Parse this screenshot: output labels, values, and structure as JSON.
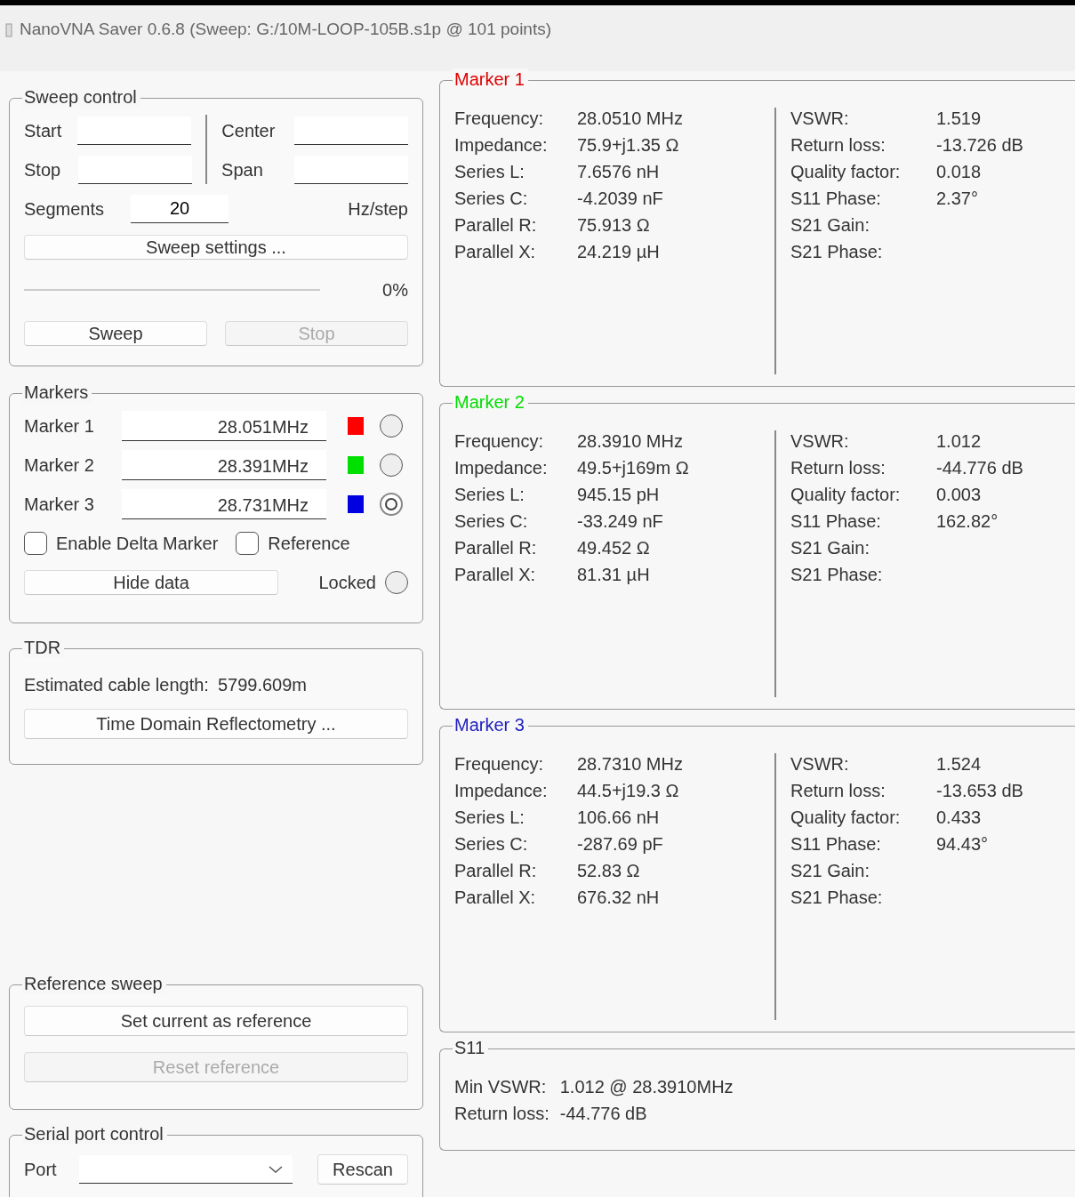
{
  "window": {
    "title": "NanoVNA Saver 0.6.8 (Sweep: G:/10M-LOOP-105B.s1p @ 101 points)"
  },
  "sweep_control": {
    "title": "Sweep control",
    "start_label": "Start",
    "center_label": "Center",
    "stop_label": "Stop",
    "span_label": "Span",
    "segments_label": "Segments",
    "segments_value": "20",
    "hz_step_label": "Hz/step",
    "settings_button": "Sweep settings ...",
    "progress": {
      "level": 0,
      "reading": "0%"
    },
    "buttons": [
      {
        "label": "Sweep",
        "disabled": false
      },
      {
        "label": "Stop",
        "disabled": true
      }
    ]
  },
  "markers": {
    "title": "Markers",
    "items": [
      {
        "label": "Marker 1",
        "value": "28.051MHz",
        "color": "#ff0000",
        "selected": false
      },
      {
        "label": "Marker 2",
        "value": "28.391MHz",
        "color": "#00e000",
        "selected": false
      },
      {
        "label": "Marker 3",
        "value": "28.731MHz",
        "color": "#0000e0",
        "selected": true
      }
    ],
    "delta": {
      "label": "Enable Delta Marker",
      "checked": false
    },
    "reference": {
      "label": "Reference",
      "checked": false
    },
    "hide_button": "Hide data",
    "locked": {
      "label": "Locked",
      "selected": false
    }
  },
  "tdr": {
    "title": "TDR",
    "label": "Estimated cable length:",
    "value": "5799.609m",
    "button": "Time Domain Reflectometry ..."
  },
  "reference_sweep": {
    "title": "Reference sweep",
    "buttons": [
      {
        "label": "Set current as reference",
        "disabled": false
      },
      {
        "label": "Reset reference",
        "disabled": true
      }
    ]
  },
  "serial_port": {
    "title": "Serial port control",
    "port_label": "Port",
    "rescan_button": "Rescan"
  },
  "marker_panels": [
    {
      "title": "Marker 1",
      "color": "#e00000",
      "left": [
        {
          "label": "Frequency:",
          "value": "28.0510 MHz"
        },
        {
          "label": "Impedance:",
          "value": "75.9+j1.35 Ω"
        },
        {
          "label": "Series L:",
          "value": "7.6576 nH"
        },
        {
          "label": "Series C:",
          "value": "-4.2039 nF"
        },
        {
          "label": "Parallel R:",
          "value": "75.913 Ω"
        },
        {
          "label": "Parallel X:",
          "value": "24.219 µH"
        }
      ],
      "right": [
        {
          "label": "VSWR:",
          "value": "1.519"
        },
        {
          "label": "Return loss:",
          "value": "-13.726 dB"
        },
        {
          "label": "Quality factor:",
          "value": "0.018"
        },
        {
          "label": "S11 Phase:",
          "value": "2.37°"
        },
        {
          "label": "S21 Gain:"
        },
        {
          "label": "S21 Phase:"
        }
      ]
    },
    {
      "title": "Marker 2",
      "color": "#00dd00",
      "left": [
        {
          "label": "Frequency:",
          "value": "28.3910 MHz"
        },
        {
          "label": "Impedance:",
          "value": "49.5+j169m Ω"
        },
        {
          "label": "Series L:",
          "value": "945.15 pH"
        },
        {
          "label": "Series C:",
          "value": "-33.249 nF"
        },
        {
          "label": "Parallel R:",
          "value": "49.452 Ω"
        },
        {
          "label": "Parallel X:",
          "value": "81.31 µH"
        }
      ],
      "right": [
        {
          "label": "VSWR:",
          "value": "1.012"
        },
        {
          "label": "Return loss:",
          "value": "-44.776 dB"
        },
        {
          "label": "Quality factor:",
          "value": "0.003"
        },
        {
          "label": "S11 Phase:",
          "value": "162.82°"
        },
        {
          "label": "S21 Gain:"
        },
        {
          "label": "S21 Phase:"
        }
      ]
    },
    {
      "title": "Marker 3",
      "color": "#2020c0",
      "left": [
        {
          "label": "Frequency:",
          "value": "28.7310 MHz"
        },
        {
          "label": "Impedance:",
          "value": "44.5+j19.3 Ω"
        },
        {
          "label": "Series L:",
          "value": "106.66 nH"
        },
        {
          "label": "Series C:",
          "value": "-287.69 pF"
        },
        {
          "label": "Parallel R:",
          "value": "52.83 Ω"
        },
        {
          "label": "Parallel X:",
          "value": "676.32 nH"
        }
      ],
      "right": [
        {
          "label": "VSWR:",
          "value": "1.524"
        },
        {
          "label": "Return loss:",
          "value": "-13.653 dB"
        },
        {
          "label": "Quality factor:",
          "value": "0.433"
        },
        {
          "label": "S11 Phase:",
          "value": "94.43°"
        },
        {
          "label": "S21 Gain:"
        },
        {
          "label": "S21 Phase:"
        }
      ]
    }
  ],
  "s11": {
    "title": "S11",
    "rows": [
      {
        "label": "Min VSWR:",
        "value": "1.012 @ 28.3910MHz"
      },
      {
        "label": "Return loss:",
        "value": "-44.776 dB"
      }
    ]
  }
}
